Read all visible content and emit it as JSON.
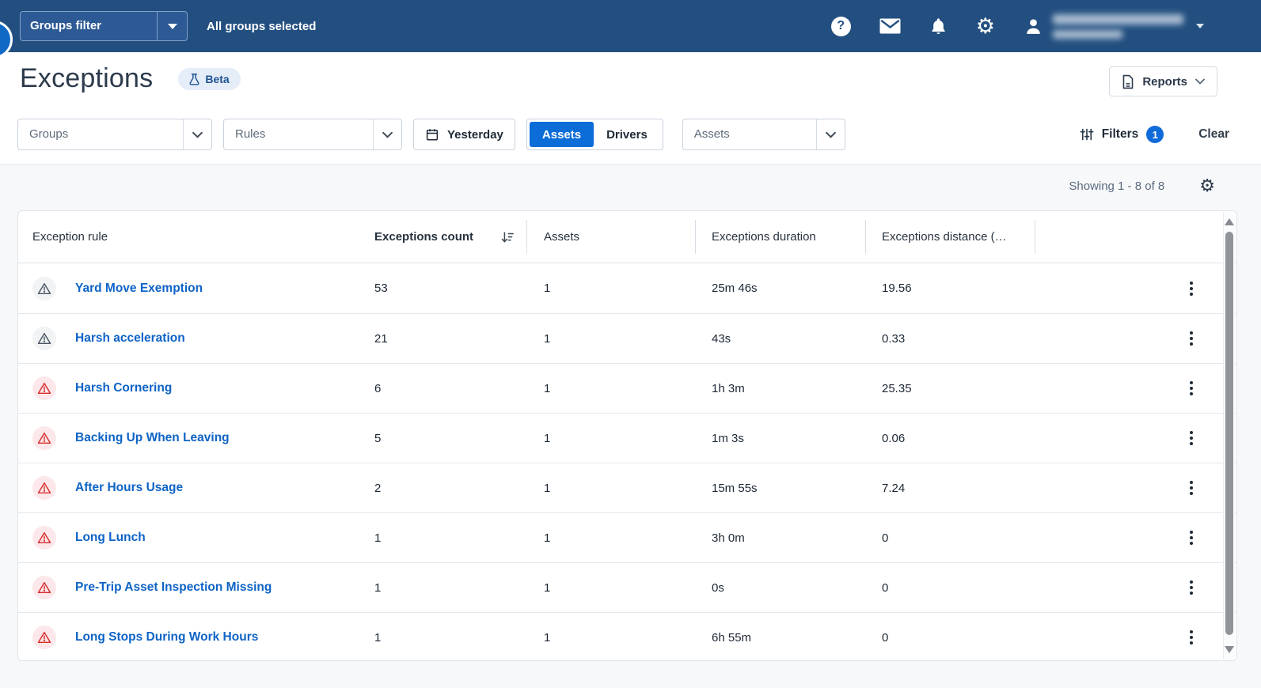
{
  "topbar": {
    "groups_filter": "Groups filter",
    "selection_status": "All groups selected"
  },
  "page": {
    "title": "Exceptions",
    "beta_badge": "Beta",
    "reports_button": "Reports"
  },
  "filter_bar": {
    "groups_placeholder": "Groups",
    "rules_placeholder": "Rules",
    "date_button": "Yesterday",
    "entity_toggle": {
      "options": [
        "Assets",
        "Drivers"
      ],
      "selected": "Assets"
    },
    "assets_placeholder": "Assets",
    "filters_button": "Filters",
    "active_filter_count": "1",
    "clear_button": "Clear"
  },
  "list_header": {
    "showing_text": "Showing 1 - 8 of 8"
  },
  "table": {
    "columns": [
      "Exception rule",
      "Exceptions count",
      "Assets",
      "Exceptions duration",
      "Exceptions distance (…"
    ],
    "sorted_by": "Exceptions count",
    "sort_direction": "desc",
    "rows": [
      {
        "rule": "Yard Move Exemption",
        "severity": "gray",
        "count": "53",
        "assets": "1",
        "duration": "25m 46s",
        "distance": "19.56"
      },
      {
        "rule": "Harsh acceleration",
        "severity": "gray",
        "count": "21",
        "assets": "1",
        "duration": "43s",
        "distance": "0.33"
      },
      {
        "rule": "Harsh Cornering",
        "severity": "red",
        "count": "6",
        "assets": "1",
        "duration": "1h 3m",
        "distance": "25.35"
      },
      {
        "rule": "Backing Up When Leaving",
        "severity": "red",
        "count": "5",
        "assets": "1",
        "duration": "1m 3s",
        "distance": "0.06"
      },
      {
        "rule": "After Hours Usage",
        "severity": "red",
        "count": "2",
        "assets": "1",
        "duration": "15m 55s",
        "distance": "7.24"
      },
      {
        "rule": "Long Lunch",
        "severity": "red",
        "count": "1",
        "assets": "1",
        "duration": "3h 0m",
        "distance": "0"
      },
      {
        "rule": "Pre-Trip Asset Inspection Missing",
        "severity": "red",
        "count": "1",
        "assets": "1",
        "duration": "0s",
        "distance": "0"
      },
      {
        "rule": "Long Stops During Work Hours",
        "severity": "red",
        "count": "1",
        "assets": "1",
        "duration": "6h 55m",
        "distance": "0"
      }
    ]
  },
  "colors": {
    "topbar_bg": "#234f80",
    "accent_blue": "#0c6dd8",
    "link_blue": "#0e63c6",
    "alert_red": "#d92b2b",
    "warning_gray": "#4a5561"
  }
}
